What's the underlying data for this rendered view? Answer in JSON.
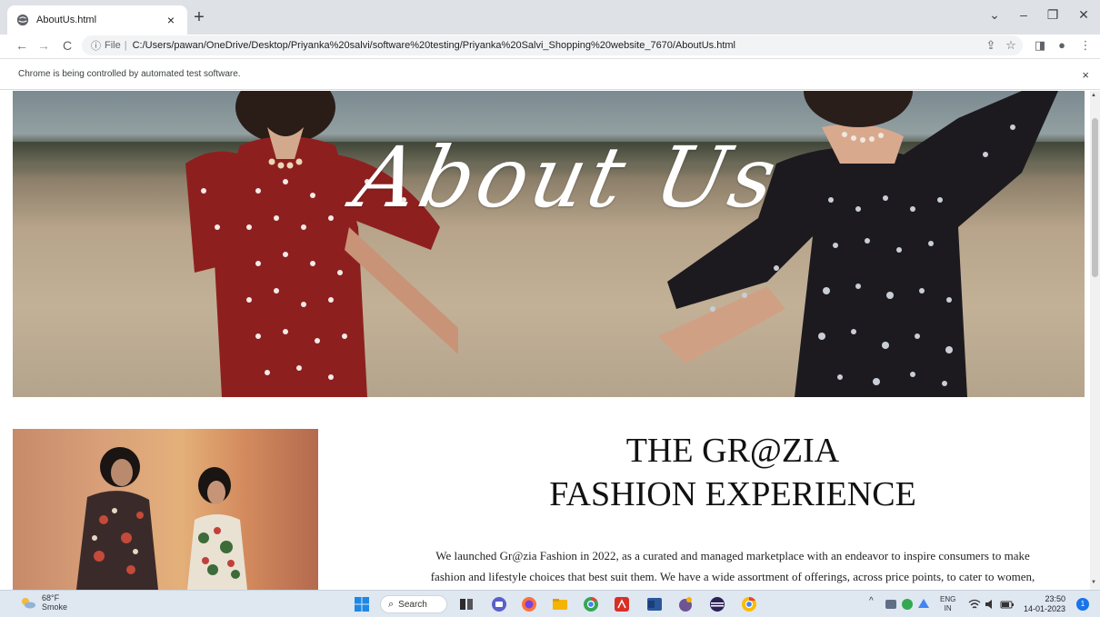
{
  "browser": {
    "tab_title": "AboutUs.html",
    "tab_close": "×",
    "new_tab": "+",
    "url_scheme": "File",
    "url_separator": "|",
    "url_path": "C:/Users/pawan/OneDrive/Desktop/Priyanka%20salvi/software%20testing/Priyanka%20Salvi_Shopping%20website_7670/AboutUs.html",
    "infobar_text": "Chrome is being controlled by automated test software.",
    "infobar_close": "×",
    "window_controls": {
      "chevron": "⌄",
      "minimize": "–",
      "restore": "❐",
      "close": "✕"
    },
    "nav": {
      "back": "←",
      "forward": "→",
      "reload": "C",
      "info": "ⓘ"
    },
    "toolbar_icons": {
      "share": "⇪",
      "bookmark": "☆",
      "sidepanel": "◨",
      "profile": "●",
      "menu": "⋮"
    }
  },
  "page": {
    "hero_title": "About Us",
    "heading_line1": "THE GR@ZIA",
    "heading_line2": "FASHION EXPERIENCE",
    "paragraph_line1": "We launched Gr@zia Fashion in 2022, as a curated and managed marketplace with an endeavor to inspire consumers to make",
    "paragraph_line2": "fashion and lifestyle choices that best suit them. We have a wide assortment of offerings, across price points, to cater to women,"
  },
  "taskbar": {
    "weather_temp": "68°F",
    "weather_desc": "Smoke",
    "search_label": "Search",
    "search_glyph": "⌕",
    "tray_chevron": "^",
    "lang_line1": "ENG",
    "lang_line2": "IN",
    "time": "23:50",
    "date": "14-01-2023",
    "notifications": "1"
  },
  "colors": {
    "accent": "#1a73e8",
    "taskbar_bg": "#dfe7f1",
    "tabstrip_bg": "#dee1e6"
  }
}
